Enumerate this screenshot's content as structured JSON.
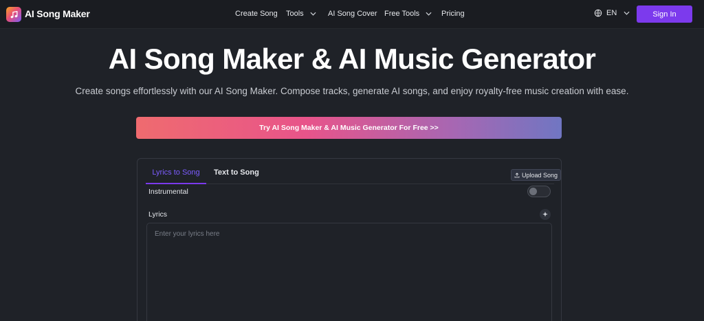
{
  "header": {
    "brand": "AI Song Maker",
    "nav": [
      {
        "label": "Create Song",
        "dropdown": false
      },
      {
        "label": "Tools",
        "dropdown": true
      },
      {
        "label": "AI Song Cover",
        "dropdown": false
      },
      {
        "label": "Free Tools",
        "dropdown": true
      },
      {
        "label": "Pricing",
        "dropdown": false
      }
    ],
    "language": "EN",
    "signin_label": "Sign In",
    "icons": {
      "logo": "music-note-icon",
      "language": "globe-icon",
      "dropdown": "chevron-down-icon"
    }
  },
  "hero": {
    "title": "AI Song Maker & AI Music Generator",
    "subtitle": "Create songs effortlessly with our AI Song Maker. Compose tracks, generate AI songs, and enjoy royalty-free music creation with ease.",
    "cta_label": "Try AI Song Maker & AI Music Generator For Free >>"
  },
  "card": {
    "tabs": [
      {
        "label": "Lyrics to Song",
        "active": true
      },
      {
        "label": "Text to Song",
        "active": false
      }
    ],
    "upload_label": "Upload Song",
    "instrumental_label": "Instrumental",
    "instrumental_on": false,
    "lyrics_label": "Lyrics",
    "lyrics_placeholder": "Enter your lyrics here",
    "lyrics_value": ""
  },
  "colors": {
    "accent": "#7c3aed",
    "background": "#1f2228",
    "header": "#1a1c21",
    "cta_gradient": [
      "#ef6b6f",
      "#e8548a",
      "#a667b3",
      "#7076c2"
    ]
  }
}
